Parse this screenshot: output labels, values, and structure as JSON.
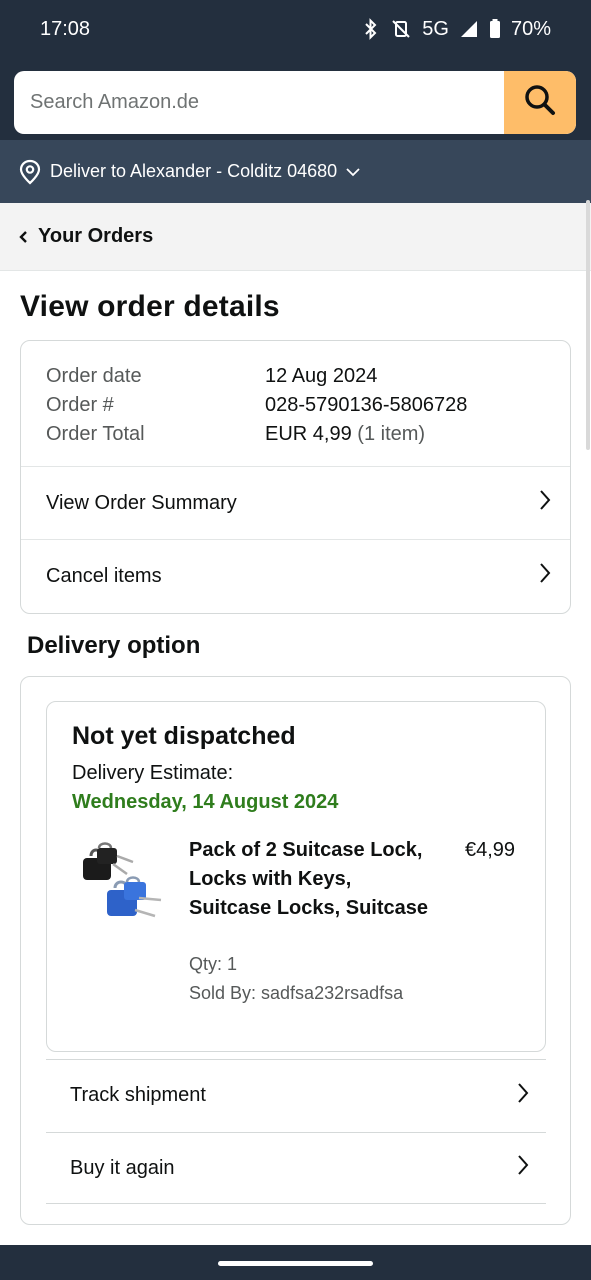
{
  "status_bar": {
    "time": "17:08",
    "network": "5G",
    "battery": "70%"
  },
  "search": {
    "placeholder": "Search Amazon.de"
  },
  "deliver": {
    "text": "Deliver to Alexander - Colditz 04680"
  },
  "breadcrumb": {
    "label": "Your Orders"
  },
  "page": {
    "title": "View order details"
  },
  "order": {
    "date_label": "Order date",
    "date_value": "12 Aug 2024",
    "number_label": "Order #",
    "number_value": "028-5790136-5806728",
    "total_label": "Order Total",
    "total_value": "EUR 4,99",
    "total_items": "(1 item)",
    "summary_link": "View Order Summary",
    "cancel_link": "Cancel items"
  },
  "delivery": {
    "section_title": "Delivery option",
    "status": "Not yet dispatched",
    "estimate_label": "Delivery Estimate:",
    "estimate_date": "Wednesday, 14 August 2024",
    "product": {
      "title": "Pack of 2 Suitcase Lock, Locks with Keys, Suitcase Locks, Suitcase",
      "price": "€4,99",
      "qty": "Qty: 1",
      "seller": "Sold By: sadfsa232rsadfsa"
    },
    "track_link": "Track shipment",
    "buy_again_link": "Buy it again"
  },
  "colors": {
    "header": "#232f3e",
    "deliver_bar": "#37475a",
    "search_button": "#febd69",
    "estimate_green": "#2f7d1d"
  },
  "icons": {
    "bluetooth": "bluetooth-icon",
    "mute": "vibrate-off-icon",
    "signal": "signal-icon",
    "battery": "battery-icon",
    "search": "search-icon",
    "location": "location-pin-icon",
    "chevron": "chevron-right-icon"
  }
}
